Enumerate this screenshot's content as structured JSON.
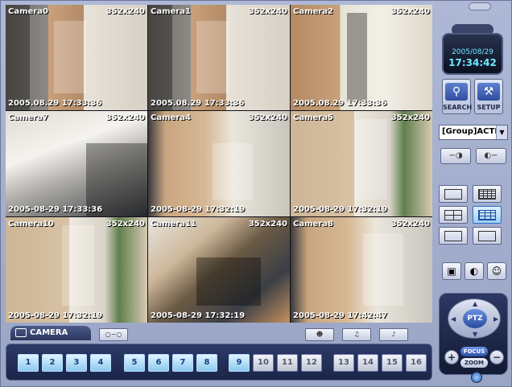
{
  "cameras": [
    {
      "name": "Camera0",
      "res": "352x240",
      "timestamp": "2005.08.29 17:33:36"
    },
    {
      "name": "Camera1",
      "res": "352x240",
      "timestamp": "2005.08.29 17:33:36"
    },
    {
      "name": "Camera2",
      "res": "352x240",
      "timestamp": "2005.08.29 17:33:36"
    },
    {
      "name": "Camera7",
      "res": "352x240",
      "timestamp": "2005-08-29 17:33:36"
    },
    {
      "name": "Camera4",
      "res": "352x240",
      "timestamp": "2005-08-29 17:32:19"
    },
    {
      "name": "Camera5",
      "res": "352x240",
      "timestamp": "2005-08-29 17:32:19"
    },
    {
      "name": "Camera10",
      "res": "352x240",
      "timestamp": "2005-08-29 17:32:19"
    },
    {
      "name": "Camera11",
      "res": "352x240",
      "timestamp": "2005-08-29 17:32:19"
    },
    {
      "name": "Camera8",
      "res": "352x240",
      "timestamp": "2005-08-29 17:42:47"
    }
  ],
  "clock": {
    "date": "2005/08/29",
    "time": "17:34:42"
  },
  "buttons": {
    "search": "SEARCH",
    "setup": "SETUP"
  },
  "group": {
    "selected": "[Group]ACTIV"
  },
  "bottom": {
    "tab": "CAMERA",
    "channels": [
      "1",
      "2",
      "3",
      "4",
      "5",
      "6",
      "7",
      "8",
      "9",
      "10",
      "11",
      "12",
      "13",
      "14",
      "15",
      "16"
    ],
    "active_count": 9
  },
  "ptz": {
    "center": "PTZ",
    "focus": "FOCUS",
    "zoom": "ZOOM"
  },
  "colors": {
    "accent": "#2a5bb5",
    "frame": "#9aa5c6",
    "clock_text": "#6fe7ff"
  }
}
